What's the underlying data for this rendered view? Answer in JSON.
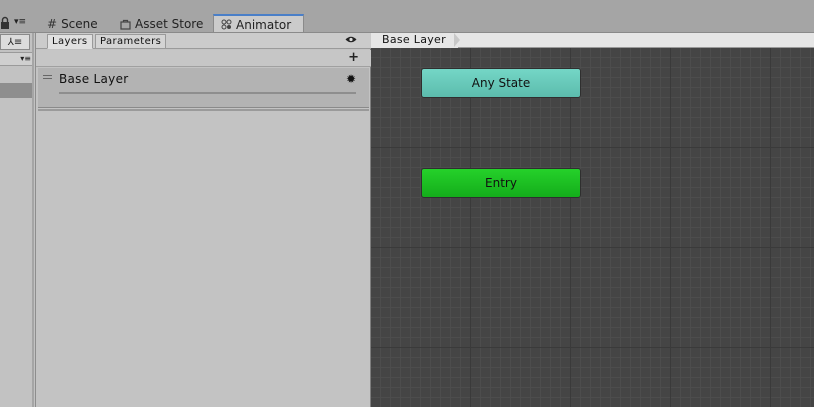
{
  "window_tabs": [
    {
      "label": "Scene",
      "icon": "scene-grid-icon"
    },
    {
      "label": "Asset Store",
      "icon": "asset-store-icon"
    },
    {
      "label": "Animator",
      "icon": "animator-icon",
      "active": true
    }
  ],
  "layers_panel": {
    "tabs": [
      {
        "label": "Layers",
        "active": true
      },
      {
        "label": "Parameters"
      }
    ],
    "add_icon": "plus-icon",
    "visibility_icon": "eye-icon",
    "layers": [
      {
        "name": "Base Layer",
        "settings_icon": "gear-icon"
      }
    ]
  },
  "graph": {
    "breadcrumb": "Base Layer",
    "nodes": [
      {
        "label": "Any State",
        "color": "#66c9b9"
      },
      {
        "label": "Entry",
        "color": "#1bc322"
      }
    ]
  },
  "colors": {
    "accent": "#4a7fc8",
    "graph_bg": "#454545",
    "panel_bg": "#c3c3c3"
  }
}
